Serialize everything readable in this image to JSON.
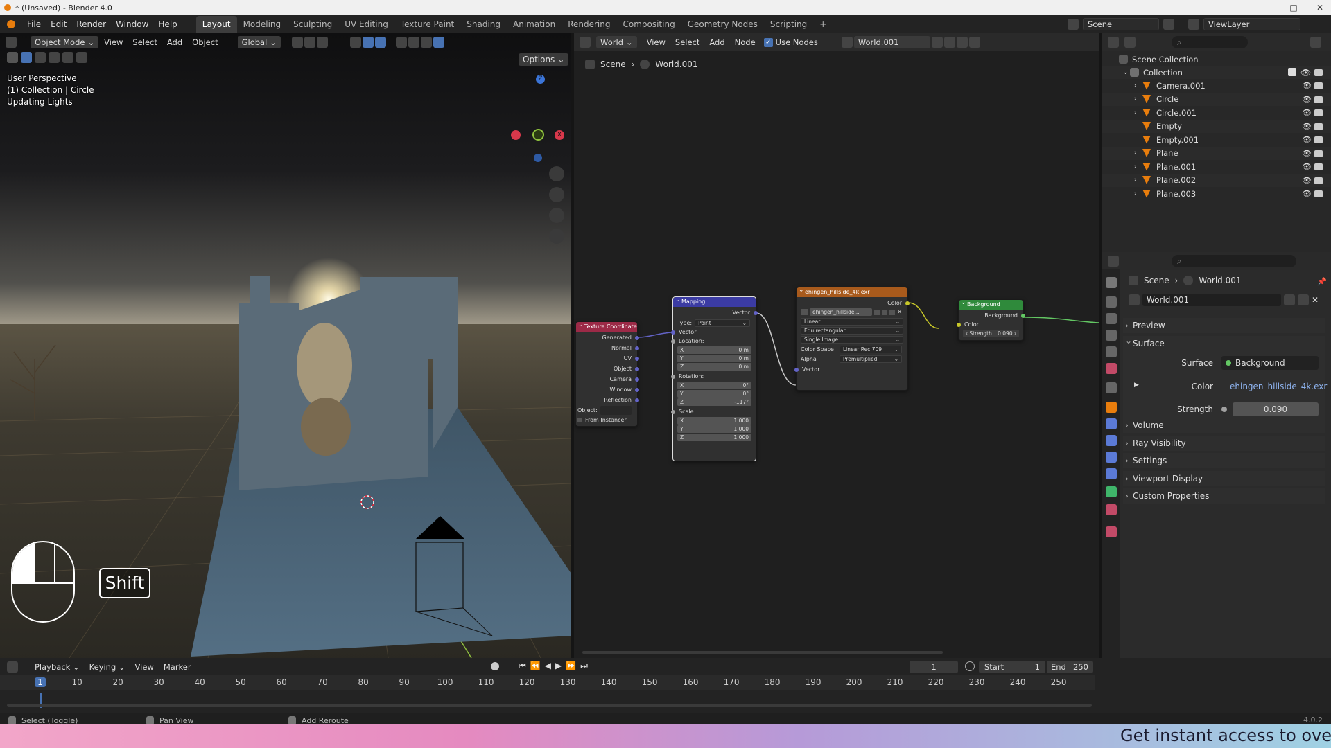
{
  "window": {
    "title": "* (Unsaved) - Blender 4.0"
  },
  "menu": [
    "File",
    "Edit",
    "Render",
    "Window",
    "Help"
  ],
  "workspaces": [
    {
      "label": "Layout",
      "active": true
    },
    {
      "label": "Modeling"
    },
    {
      "label": "Sculpting"
    },
    {
      "label": "UV Editing"
    },
    {
      "label": "Texture Paint"
    },
    {
      "label": "Shading"
    },
    {
      "label": "Animation"
    },
    {
      "label": "Rendering"
    },
    {
      "label": "Compositing"
    },
    {
      "label": "Geometry Nodes"
    },
    {
      "label": "Scripting"
    }
  ],
  "add_workspace": "+",
  "scene_selector": {
    "scene": "Scene",
    "view_layer": "ViewLayer"
  },
  "viewport_header": {
    "mode": "Object Mode",
    "menus": [
      "View",
      "Select",
      "Add",
      "Object"
    ],
    "orientation": "Global",
    "options": "Options"
  },
  "viewport_overlay": {
    "line1": "User Perspective",
    "line2": "(1) Collection | Circle",
    "line3": "Updating Lights"
  },
  "gizmo": {
    "x": "X",
    "y": "Y",
    "z": "Z"
  },
  "key_overlay": "Shift",
  "node_header": {
    "type": "World",
    "menus": [
      "View",
      "Select",
      "Add",
      "Node"
    ],
    "use_nodes": "Use Nodes",
    "world_name": "World.001"
  },
  "node_breadcrumb": {
    "scene": "Scene",
    "world": "World.001"
  },
  "nodes": {
    "texcoord": {
      "title": "Texture Coordinate",
      "outputs": [
        "Generated",
        "Normal",
        "UV",
        "Object",
        "Camera",
        "Window",
        "Reflection"
      ],
      "object_label": "Object:",
      "from_instancer": "From Instancer"
    },
    "mapping": {
      "title": "Mapping",
      "out": "Vector",
      "type_label": "Type:",
      "type_value": "Point",
      "in_vector": "Vector",
      "location": "Location:",
      "loc": [
        {
          "a": "X",
          "v": "0 m"
        },
        {
          "a": "Y",
          "v": "0 m"
        },
        {
          "a": "Z",
          "v": "0 m"
        }
      ],
      "rotation": "Rotation:",
      "rot": [
        {
          "a": "X",
          "v": "0°"
        },
        {
          "a": "Y",
          "v": "0°"
        },
        {
          "a": "Z",
          "v": "-117°"
        }
      ],
      "scale": "Scale:",
      "scl": [
        {
          "a": "X",
          "v": "1.000"
        },
        {
          "a": "Y",
          "v": "1.000"
        },
        {
          "a": "Z",
          "v": "1.000"
        }
      ]
    },
    "envtex": {
      "title": "ehingen_hillside_4k.exr",
      "out": "Color",
      "image": "ehingen_hillside...",
      "interp": "Linear",
      "proj": "Equirectangular",
      "source": "Single Image",
      "cs_label": "Color Space",
      "cs_value": "Linear Rec.709",
      "alpha_label": "Alpha",
      "alpha_value": "Premultiplied",
      "in_vector": "Vector"
    },
    "background": {
      "title": "Background",
      "out": "Background",
      "in_color": "Color",
      "strength_label": "Strength",
      "strength_value": "0.090"
    }
  },
  "outliner": {
    "root": "Scene Collection",
    "collection": "Collection",
    "items": [
      "Camera.001",
      "Circle",
      "Circle.001",
      "Empty",
      "Empty.001",
      "Plane",
      "Plane.001",
      "Plane.002",
      "Plane.003"
    ]
  },
  "properties": {
    "breadcrumb_scene": "Scene",
    "breadcrumb_world": "World.001",
    "world_name": "World.001",
    "panels": {
      "preview": "Preview",
      "surface": "Surface",
      "volume": "Volume",
      "ray_visibility": "Ray Visibility",
      "settings": "Settings",
      "viewport_display": "Viewport Display",
      "custom_properties": "Custom Properties"
    },
    "surface_label": "Surface",
    "surface_value": "Background",
    "color_label": "Color",
    "color_value": "ehingen_hillside_4k.exr",
    "strength_label": "Strength",
    "strength_value": "0.090"
  },
  "timeline": {
    "menus": [
      "Playback",
      "Keying",
      "View",
      "Marker"
    ],
    "current_frame": "1",
    "start_label": "Start",
    "start": "1",
    "end_label": "End",
    "end": "250",
    "ticks": [
      "1",
      "10",
      "20",
      "30",
      "40",
      "50",
      "60",
      "70",
      "80",
      "90",
      "100",
      "110",
      "120",
      "130",
      "140",
      "150",
      "160",
      "170",
      "180",
      "190",
      "200",
      "210",
      "220",
      "230",
      "240",
      "250"
    ]
  },
  "status": {
    "select": "Select (Toggle)",
    "pan": "Pan View",
    "reroute": "Add Reroute",
    "version": "4.0.2"
  },
  "banner": "Get instant access to over",
  "colors": {
    "accent": "#4772b3",
    "orange": "#e87d0d",
    "mapping_header": "#3b3ba3",
    "texcoord_header": "#9c2a47",
    "envtex_header": "#a85a1c",
    "bg_header": "#2f8a3b"
  }
}
